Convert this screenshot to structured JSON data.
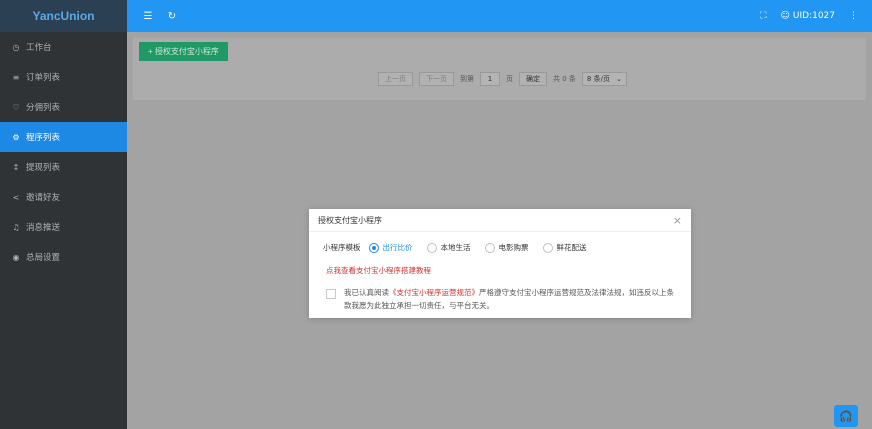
{
  "brand": "YancUnion",
  "sidebar": {
    "items": [
      {
        "icon": "dashboard-icon",
        "glyph": "◷",
        "label": "工作台"
      },
      {
        "icon": "list-icon",
        "glyph": "≡",
        "label": "订单列表"
      },
      {
        "icon": "share-icon",
        "glyph": "♡",
        "label": "分佣列表"
      },
      {
        "icon": "program-icon",
        "glyph": "⚙",
        "label": "程序列表"
      },
      {
        "icon": "withdraw-icon",
        "glyph": "↕",
        "label": "提现列表"
      },
      {
        "icon": "invite-icon",
        "glyph": "<",
        "label": "邀请好友"
      },
      {
        "icon": "bell-icon",
        "glyph": "♫",
        "label": "消息推送"
      },
      {
        "icon": "settings-icon",
        "glyph": "◉",
        "label": "总局设置"
      }
    ],
    "active_index": 3
  },
  "topbar": {
    "menu_glyph": "☰",
    "refresh_glyph": "↻",
    "fullscreen_glyph": "⛶",
    "user_glyph": "☺",
    "user": "UID:1027",
    "more_glyph": "⋮"
  },
  "toolbar": {
    "add_label": "+ 授权支付宝小程序"
  },
  "pager": {
    "prev": "上一页",
    "next": "下一页",
    "goto": "到第",
    "page": "1",
    "page_unit": "页",
    "confirm": "确定",
    "total": "共 0 条",
    "per_page": "8 条/页",
    "caret": "⌄"
  },
  "modal": {
    "title": "授权支付宝小程序",
    "close": "×",
    "template_label": "小程序模板",
    "options": [
      "出行比价",
      "本地生活",
      "电影购票",
      "鲜花配送"
    ],
    "selected_index": 0,
    "tutorial_link": "点我查看支付宝小程序搭建教程",
    "agree_prefix": "我已认真阅读",
    "agree_link": "《支付宝小程序运营规范》",
    "agree_suffix": "严格遵守支付宝小程序运营规范及法律法规，如违反以上条款我愿为此独立承担一切责任，与平台无关。"
  },
  "help": {
    "glyph": "🎧"
  },
  "colors": {
    "sidebar_bg": "#2f3336",
    "active": "#1e88e5",
    "topbar": "#2196f3",
    "primary_btn": "#1f9a66",
    "link_red": "#d32f2f"
  }
}
